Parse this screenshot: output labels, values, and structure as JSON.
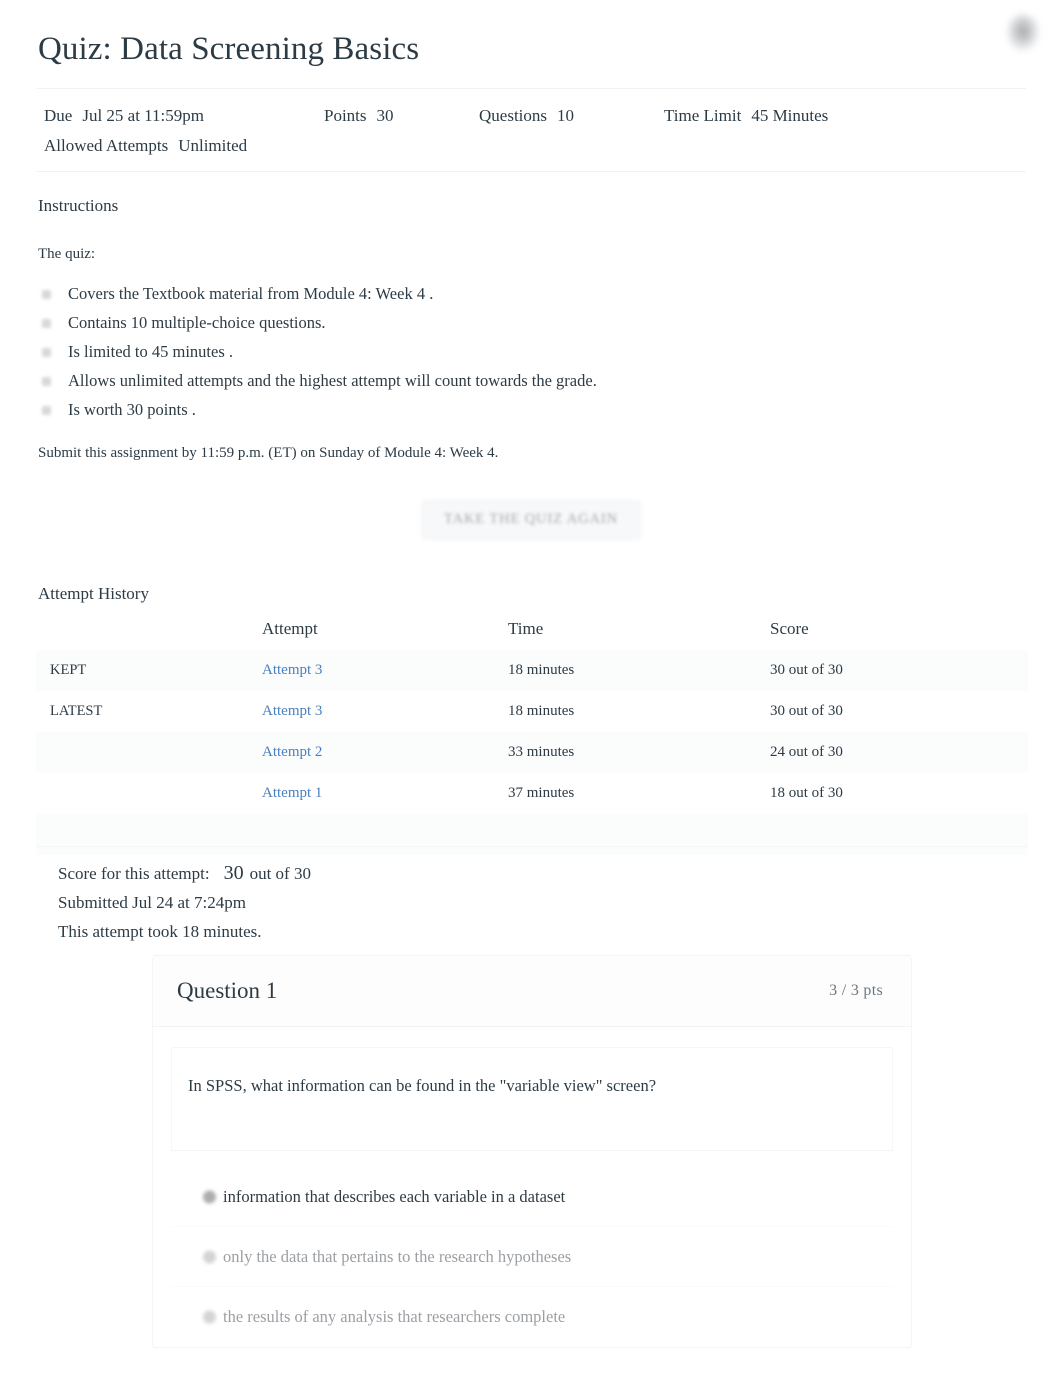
{
  "header": {
    "title": "Quiz: Data Screening Basics",
    "avatar_icon": "user-avatar-icon"
  },
  "meta": {
    "due_label": "Due",
    "due_value": "Jul 25 at 11:59pm",
    "points_label": "Points",
    "points_value": "30",
    "questions_label": "Questions",
    "questions_value": "10",
    "time_limit_label": "Time Limit",
    "time_limit_value": "45 Minutes",
    "allowed_attempts_label": "Allowed Attempts",
    "allowed_attempts_value": "Unlimited"
  },
  "instructions": {
    "heading": "Instructions",
    "lead": "The quiz:",
    "bullets": [
      "Covers the   Textbook   material from   Module 4: Week 4   .",
      "Contains   10 multiple-choice     questions.",
      "Is limited  to 45 minutes   .",
      "Allows  unlimited  attempts    and the   highest   attempt will count towards the grade.",
      "Is worth 30 points    ."
    ],
    "closing": "Submit this assignment by 11:59 p.m. (ET) on Sunday of Module 4: Week 4."
  },
  "take_again": {
    "label": "TAKE THE QUIZ AGAIN"
  },
  "attempt_history": {
    "heading": "Attempt History",
    "columns": [
      "",
      "Attempt",
      "Time",
      "Score"
    ],
    "rows": [
      {
        "marker": "KEPT",
        "attempt": "Attempt 3",
        "time": "18 minutes",
        "score": "30 out of 30"
      },
      {
        "marker": "LATEST",
        "attempt": "Attempt 3",
        "time": "18 minutes",
        "score": "30 out of 30"
      },
      {
        "marker": "",
        "attempt": "Attempt 2",
        "time": "33 minutes",
        "score": "24 out of 30"
      },
      {
        "marker": "",
        "attempt": "Attempt 1",
        "time": "37 minutes",
        "score": "18 out of 30"
      }
    ]
  },
  "score_summary": {
    "score_label": "Score for this attempt:",
    "score_value": "30",
    "score_suffix": "out of 30",
    "submitted": "Submitted Jul 24 at 7:24pm",
    "duration": "This attempt took 18 minutes."
  },
  "question": {
    "title": "Question 1",
    "points": "3 / 3 pts",
    "text": "In SPSS, what information can be found in the \"variable view\" screen?",
    "answers": [
      {
        "text": "information that describes each variable in a dataset",
        "selected": true
      },
      {
        "text": "only the data that pertains to the research hypotheses",
        "selected": false
      },
      {
        "text": "the results of any analysis that researchers complete",
        "selected": false
      }
    ]
  },
  "colors": {
    "text": "#2d3b45",
    "link": "#4a7fc1",
    "muted": "#9b9fa3",
    "band": "#fbfcfc"
  }
}
